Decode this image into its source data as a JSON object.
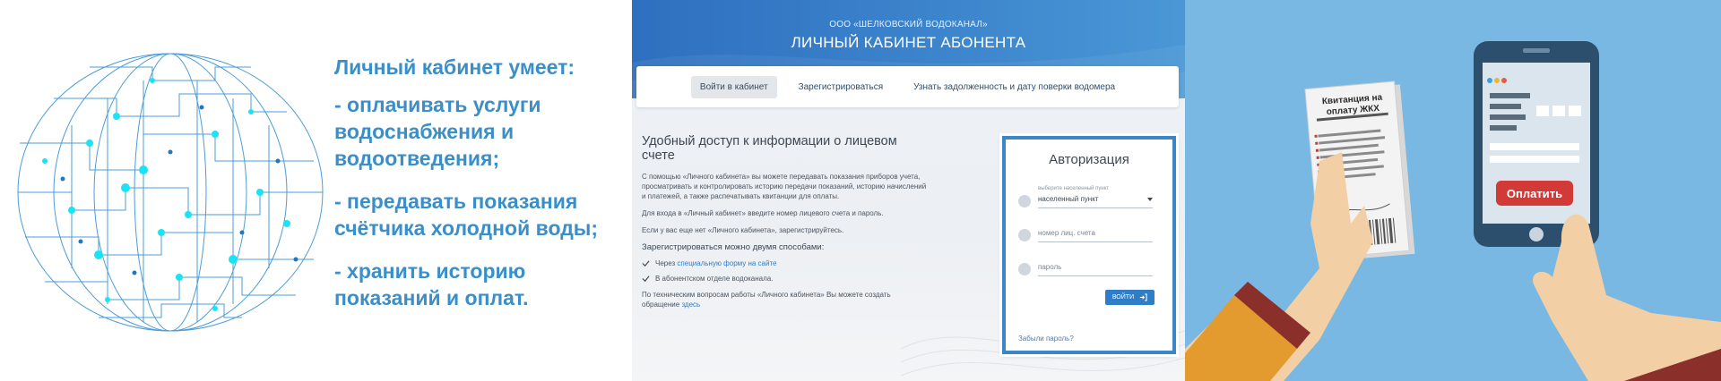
{
  "left_panel": {
    "heading": "Личный кабинет умеет:",
    "items": [
      "- оплачивать услуги водоснабжения и водоотведения;",
      "- передавать показания счётчика холодной воды;",
      "- хранить историю показаний и оплат."
    ],
    "colors": {
      "text": "#3a8fc8",
      "globe": "#2d8bd0",
      "globe_accent": "#19e3f5"
    }
  },
  "portal": {
    "company": "ООО «ШЕЛКОВСКИЙ ВОДОКАНАЛ»",
    "title": "ЛИЧНЫЙ КАБИНЕТ АБОНЕНТА",
    "nav": [
      {
        "label": "Войти в кабинет",
        "active": true
      },
      {
        "label": "Зарегистрироваться",
        "active": false
      },
      {
        "label": "Узнать задолженность и дату поверки водомера",
        "active": false
      }
    ],
    "info": {
      "title": "Удобный доступ к информации о лицевом счете",
      "paragraph1": "С помощью «Личного кабинета» вы можете передавать показания приборов учета, просматривать и контролировать историю передачи показаний, историю начислений и платежей, а также распечатывать квитанции для оплаты.",
      "paragraph2": "Для входа в «Личный кабинет» введите номер лицевого счета и пароль.",
      "paragraph3": "Если у вас еще нет «Личного кабинета», зарегистрируйтесь.",
      "reg_title": "Зарегистрироваться можно двумя способами:",
      "way1_prefix": "Через ",
      "way1_link": "специальную форму на сайте",
      "way2": "В абонентском отделе водоканала.",
      "support_prefix": "По техническим вопросам работы «Личного кабинета» Вы можете создать обращение ",
      "support_link": "здесь"
    },
    "auth": {
      "title": "Авторизация",
      "locality_label": "выберите населенный пункт",
      "locality_value": "населенный пункт",
      "account_placeholder": "номер лиц. счета",
      "password_placeholder": "пароль",
      "login_button": "ВОЙТИ",
      "forgot": "Забыли пароль?"
    },
    "colors": {
      "header": "#3c84cc",
      "accent": "#2f7dc6",
      "auth_border": "#3a86c6"
    }
  },
  "illustration": {
    "receipt_title": "Квитанция на оплату ЖКХ",
    "pay_button": "Оплатить",
    "colors": {
      "background": "#78b8e2",
      "pay": "#d13a37",
      "phone": "#2c4f6e",
      "sleeve": "#e39a2e"
    }
  }
}
